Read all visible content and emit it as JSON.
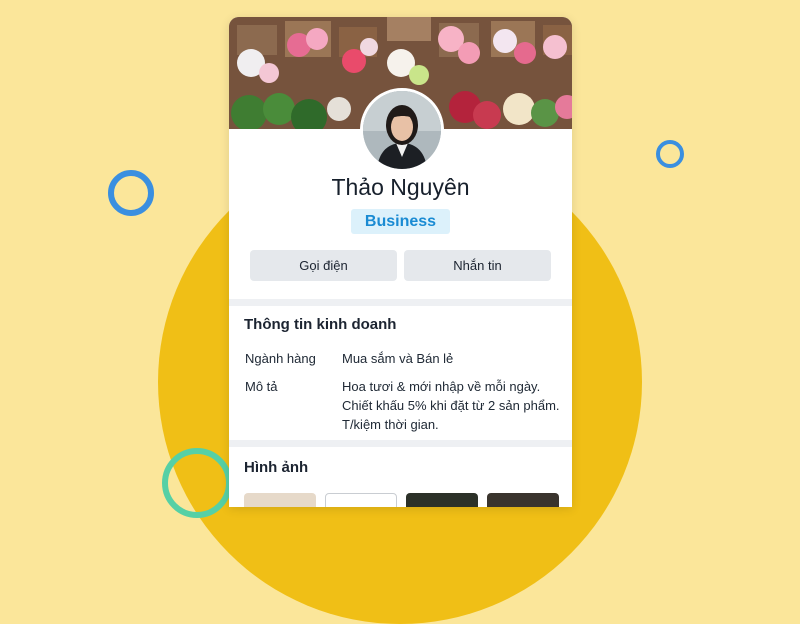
{
  "profile": {
    "name": "Thảo Nguyên",
    "badge": "Business",
    "actions": {
      "call": "Gọi điện",
      "message": "Nhắn tin"
    }
  },
  "business_info": {
    "title": "Thông tin kinh doanh",
    "rows": [
      {
        "label": "Ngành hàng",
        "value": "Mua sắm và Bán lẻ"
      },
      {
        "label": "Mô tả",
        "value": "Hoa tươi & mới nhập về mỗi ngày. Chiết khấu 5% khi đặt từ 2 sản phẩm. T/kiệm thời gian."
      }
    ]
  },
  "photos": {
    "title": "Hình ảnh"
  },
  "colors": {
    "background": "#fbe69a",
    "circle": "#f0bf16",
    "accent_blue": "#3a8fe0",
    "accent_green": "#56d0a5",
    "badge_bg": "#dcf1fb",
    "badge_text": "#1a8bd3"
  }
}
